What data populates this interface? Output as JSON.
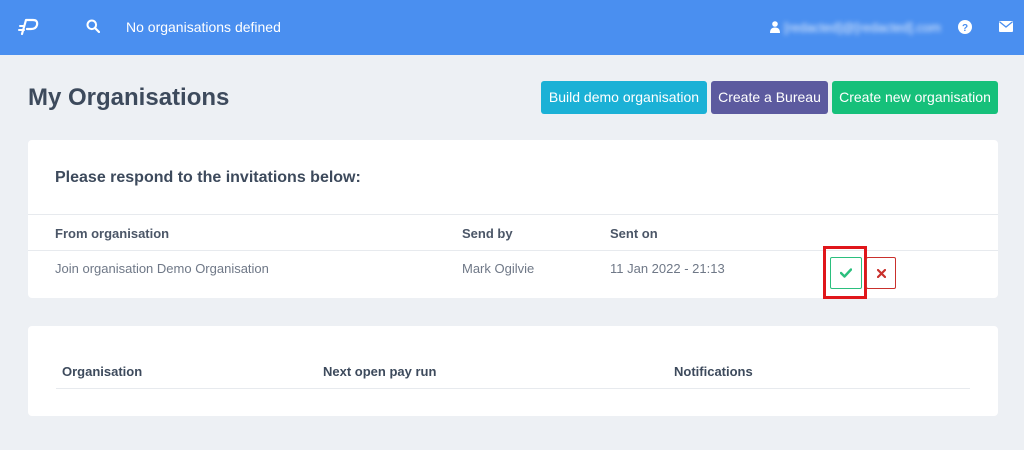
{
  "topbar": {
    "org_status": "No organisations defined",
    "user_email": "[redacted]@[redacted].com",
    "icons": [
      "logo-icon",
      "search-icon",
      "user-icon",
      "help-icon",
      "mail-icon"
    ]
  },
  "page": {
    "title": "My Organisations"
  },
  "actions": {
    "build_demo": "Build demo organisation",
    "create_bureau": "Create a Bureau",
    "create_new": "Create new organisation"
  },
  "invitations": {
    "heading": "Please respond to the invitations below:",
    "columns": [
      "From organisation",
      "Send by",
      "Sent on"
    ],
    "rows": [
      {
        "from_organisation": "Join organisation Demo Organisation",
        "sent_by": "Mark Ogilvie",
        "sent_on": "11 Jan 2022 - 21:13"
      }
    ]
  },
  "organisations": {
    "columns": [
      "Organisation",
      "Next open pay run",
      "Notifications"
    ]
  },
  "colors": {
    "topbar": "#4a8ff0",
    "build_demo": "#1bb1d6",
    "create_bureau": "#5c5a9f",
    "create_new": "#16c07a",
    "accept": "#2bbf7e",
    "decline": "#c9302c",
    "highlight": "#e0161b"
  }
}
